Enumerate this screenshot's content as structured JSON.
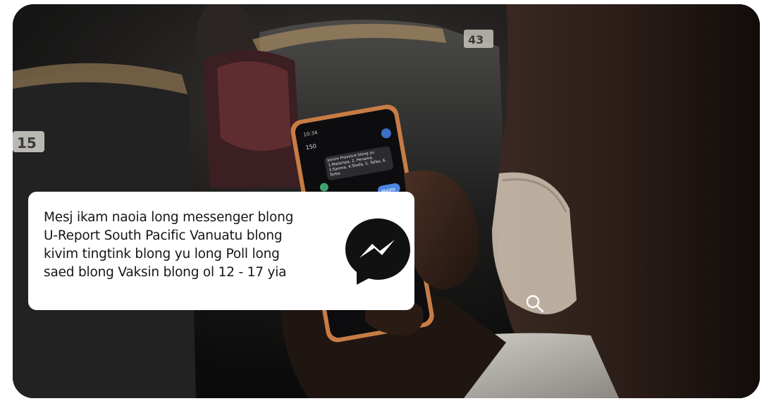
{
  "caption": {
    "text": "Mesj ikam naoia long messenger  blong\nU-Report South Pacific Vanuatu blong\nkivim tingtink blong yu long Poll long\nsaed blong Vaksin blong ol  12 - 17 yia"
  },
  "phone_screen": {
    "status_time": "10:34",
    "contact_number": "150",
    "message": "Joinim Province blong yu 1.Malampa, 2. Penama, 3.Sanma, 4.Shefa, 5. Tafea, 6. Torba",
    "reply": "Malafa"
  },
  "seat_number_left": "15",
  "seat_number_right": "43",
  "icons": {
    "brand": "messenger-icon",
    "overlay": "search-icon"
  },
  "colors": {
    "card_background": "#ffffff",
    "caption_text": "#161616",
    "messenger_badge": "#111111"
  }
}
